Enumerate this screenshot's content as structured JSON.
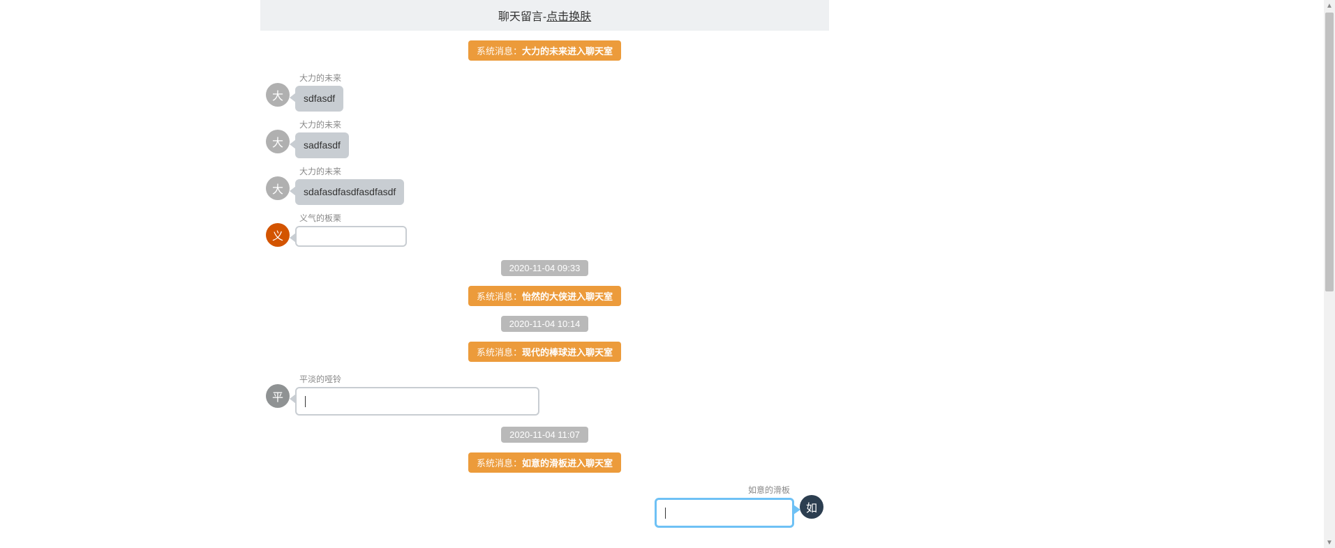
{
  "header": {
    "title_prefix": "聊天留言-",
    "theme_link": "点击换肤"
  },
  "labels": {
    "system": "系统消息"
  },
  "timeline": [
    {
      "type": "system",
      "text": "大力的未来进入聊天室"
    },
    {
      "type": "msg",
      "side": "left",
      "avatar_char": "大",
      "avatar_cls": "av-gray",
      "name": "大力的未来",
      "bubble_cls": "bub-gray",
      "tail": "tail-left tail-gray",
      "content": "sdfasdf"
    },
    {
      "type": "msg",
      "side": "left",
      "avatar_char": "大",
      "avatar_cls": "av-gray",
      "name": "大力的未来",
      "bubble_cls": "bub-gray",
      "tail": "tail-left tail-gray",
      "content": "sadfasdf"
    },
    {
      "type": "msg",
      "side": "left",
      "avatar_char": "大",
      "avatar_cls": "av-gray",
      "name": "大力的未来",
      "bubble_cls": "bub-gray",
      "tail": "tail-left tail-gray",
      "content": "sdafasdfasdfasdfasdf"
    },
    {
      "type": "msg",
      "side": "left",
      "avatar_char": "义",
      "avatar_cls": "av-orange",
      "name": "义气的板栗",
      "bubble_cls": "bub-white",
      "tail": "tail-left tail-border",
      "content": ""
    },
    {
      "type": "time",
      "text": "2020-11-04 09:33"
    },
    {
      "type": "system",
      "text": "怡然的大侠进入聊天室"
    },
    {
      "type": "time",
      "text": "2020-11-04 10:14"
    },
    {
      "type": "system",
      "text": "现代的棒球进入聊天室"
    },
    {
      "type": "msg",
      "side": "left",
      "avatar_char": "平",
      "avatar_cls": "av-graydk",
      "name": "平淡的哑铃",
      "bubble_cls": "bub-white-wide",
      "tail": "tail-left tail-border",
      "content": "",
      "show_cursor": true
    },
    {
      "type": "time",
      "text": "2020-11-04 11:07"
    },
    {
      "type": "system",
      "text": "如意的滑板进入聊天室"
    },
    {
      "type": "msg",
      "side": "right",
      "avatar_char": "如",
      "avatar_cls": "av-navy",
      "name": "如意的滑板",
      "bubble_cls": "bub-self",
      "tail": "tail-right",
      "content": "",
      "show_cursor": true
    }
  ]
}
